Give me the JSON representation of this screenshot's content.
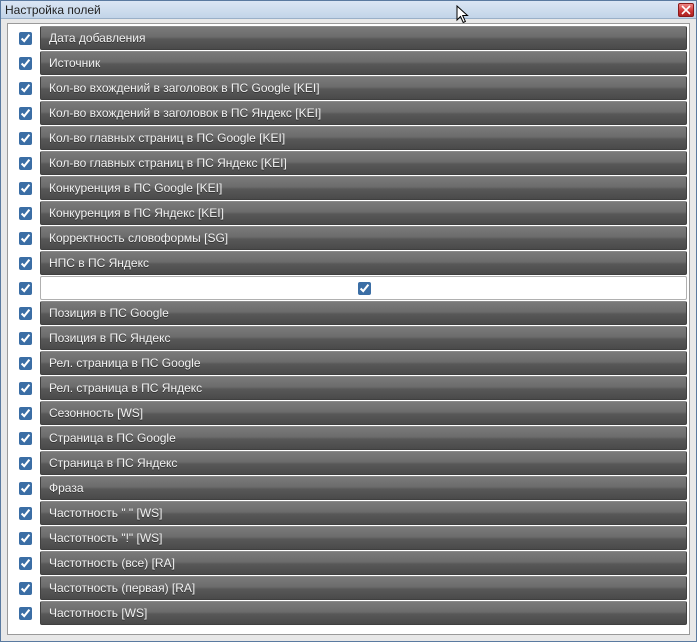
{
  "window": {
    "title": "Настройка полей"
  },
  "rows": [
    {
      "checked": true,
      "label": "Дата добавления",
      "edit": false
    },
    {
      "checked": true,
      "label": "Источник",
      "edit": false
    },
    {
      "checked": true,
      "label": "Кол-во вхождений в заголовок в ПС Google [KEI]",
      "edit": false
    },
    {
      "checked": true,
      "label": "Кол-во вхождений в заголовок в ПС Яндекс [KEI]",
      "edit": false
    },
    {
      "checked": true,
      "label": "Кол-во главных страниц в ПС Google [KEI]",
      "edit": false
    },
    {
      "checked": true,
      "label": "Кол-во главных страниц в ПС Яндекс [KEI]",
      "edit": false
    },
    {
      "checked": true,
      "label": "Конкуренция в ПС Google [KEI]",
      "edit": false
    },
    {
      "checked": true,
      "label": "Конкуренция в ПС Яндекс [KEI]",
      "edit": false
    },
    {
      "checked": true,
      "label": "Корректность словоформы [SG]",
      "edit": false
    },
    {
      "checked": true,
      "label": "НПС в ПС Яндекс",
      "edit": false
    },
    {
      "checked": true,
      "label": "",
      "edit": true,
      "inlineChecked": true
    },
    {
      "checked": true,
      "label": "Позиция в ПС Google",
      "edit": false
    },
    {
      "checked": true,
      "label": "Позиция в ПС Яндекс",
      "edit": false
    },
    {
      "checked": true,
      "label": "Рел. страница в ПС Google",
      "edit": false
    },
    {
      "checked": true,
      "label": "Рел. страница в ПС Яндекс",
      "edit": false
    },
    {
      "checked": true,
      "label": "Сезонность [WS]",
      "edit": false
    },
    {
      "checked": true,
      "label": "Страница в ПС Google",
      "edit": false
    },
    {
      "checked": true,
      "label": "Страница в ПС Яндекс",
      "edit": false
    },
    {
      "checked": true,
      "label": "Фраза",
      "edit": false
    },
    {
      "checked": true,
      "label": "Частотность \" \" [WS]",
      "edit": false
    },
    {
      "checked": true,
      "label": "Частотность \"!\" [WS]",
      "edit": false
    },
    {
      "checked": true,
      "label": "Частотность (все) [RA]",
      "edit": false
    },
    {
      "checked": true,
      "label": "Частотность (первая) [RA]",
      "edit": false
    },
    {
      "checked": true,
      "label": "Частотность [WS]",
      "edit": false
    }
  ]
}
